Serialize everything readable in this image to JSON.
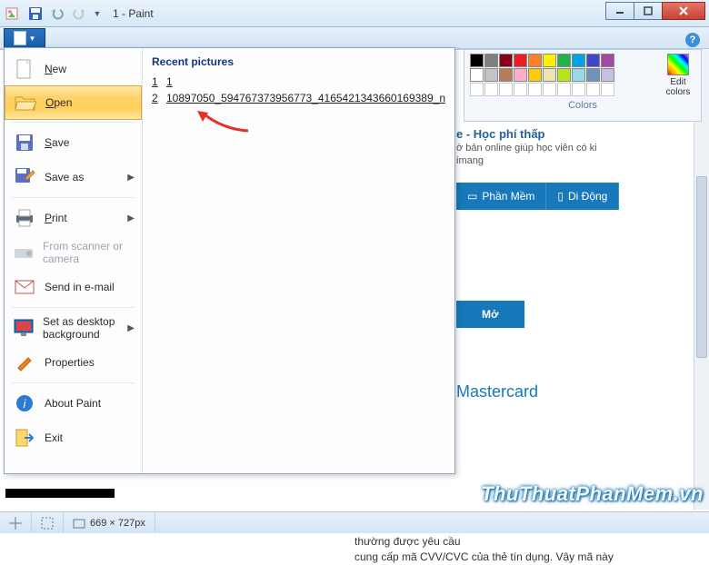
{
  "window": {
    "title": "1 - Paint"
  },
  "filemenu": {
    "items": {
      "new": "New",
      "open": "Open",
      "save": "Save",
      "saveas": "Save as",
      "print": "Print",
      "scanner": "From scanner or camera",
      "email": "Send in e-mail",
      "desktop": "Set as desktop background",
      "properties": "Properties",
      "about": "About Paint",
      "exit": "Exit"
    },
    "recent_title": "Recent pictures",
    "recent": [
      {
        "n": "1",
        "name": "1"
      },
      {
        "n": "2",
        "name": "10897050_594767373956773_4165421343660169389_n"
      }
    ]
  },
  "colors": {
    "label": "Colors",
    "edit": "Edit colors",
    "row1": [
      "#000000",
      "#7f7f7f",
      "#880015",
      "#ed1c24",
      "#ff7f27",
      "#fff200",
      "#22b14c",
      "#00a2e8",
      "#3f48cc",
      "#a349a4"
    ],
    "row2": [
      "#ffffff",
      "#c3c3c3",
      "#b97a57",
      "#ffaec9",
      "#ffc90e",
      "#efe4b0",
      "#b5e61d",
      "#99d9ea",
      "#7092be",
      "#c8bfe7"
    ]
  },
  "content": {
    "head": "e - Học phí thấp",
    "sub1": "ờ bản online giúp học viên có ki",
    "sub2": "imang",
    "tab1": "Phần Mềm",
    "tab2": "Di Động",
    "open": "Mở",
    "master": "Mastercard",
    "body1": "thường được yêu cầu",
    "body2": "cung cấp mã CVV/CVC của thẻ tín dụng. Vậy mã này"
  },
  "status": {
    "dims": "669 × 727px"
  },
  "watermark": "ThuThuatPhanMem.vn"
}
